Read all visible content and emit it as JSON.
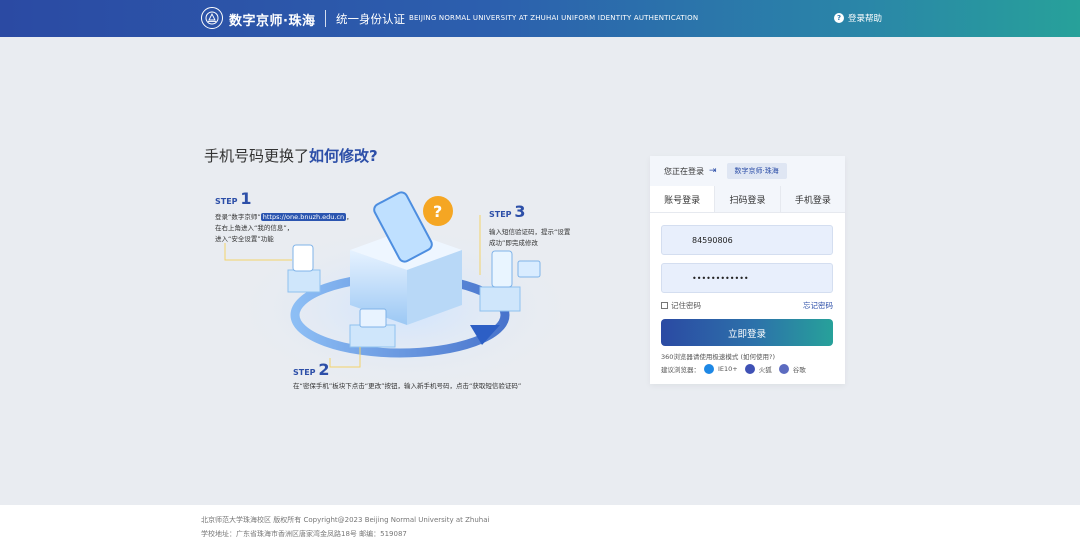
{
  "header": {
    "brand": "数字京师·珠海",
    "subtitle": "统一身份认证",
    "subtitle_en": "BEIJING NORMAL UNIVERSITY AT ZHUHAI UNIFORM IDENTITY AUTHENTICATION",
    "help": "登录帮助"
  },
  "headline": {
    "prefix": "手机号码更换了",
    "emphasis": "如何修改?"
  },
  "steps": [
    {
      "label": "STEP",
      "num": "1",
      "line1_a": "登录“数字京师”",
      "link": "https://one.bnuzh.edu.cn",
      "line1_b": "，",
      "line2": "在右上角进入“我的信息”，",
      "line3": "进入“安全设置”功能"
    },
    {
      "label": "STEP",
      "num": "2",
      "line1": "在“密保手机”板块下点击“更改”按钮，输入新手机号码，点击“获取短信验证码”"
    },
    {
      "label": "STEP",
      "num": "3",
      "line1": "输入短信验证码，提示“设置",
      "line2": "成功”即完成修改"
    }
  ],
  "card": {
    "now_login": "您正在登录",
    "site": "数字京师·珠海",
    "tabs": [
      "账号登录",
      "扫码登录",
      "手机登录"
    ],
    "username": "84590806",
    "password": "••••••••••••",
    "remember": "记住密码",
    "forgot": "忘记密码",
    "login_btn": "立即登录",
    "tip": "360浏览器请使用极速模式 (如何使用?)",
    "browsers_label": "建议浏览器：",
    "browsers": [
      "IE10+",
      "火狐",
      "谷歌"
    ]
  },
  "footer": {
    "line1": "北京师范大学珠海校区 版权所有 Copyright@2023 Beijing Normal University at Zhuhai",
    "line2": "学校地址：广东省珠海市香洲区唐家湾金凤路18号 邮编：519087"
  },
  "colors": {
    "primary": "#2d4fa8",
    "accent_teal": "#27a19a"
  }
}
